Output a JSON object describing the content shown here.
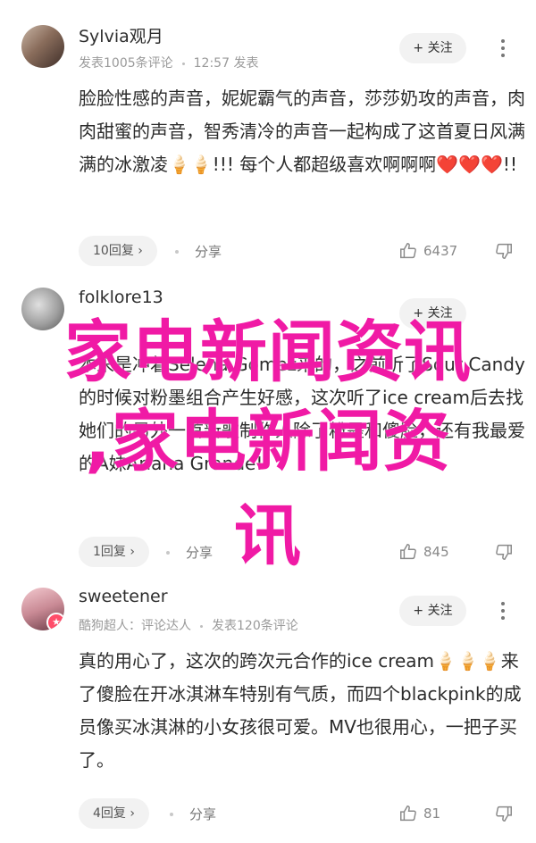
{
  "comments": [
    {
      "username": "Sylvia观月",
      "meta_prefix": "发表1005条评论",
      "time": "12:57",
      "meta_suffix": "发表",
      "follow": "+ 关注",
      "body": "脸脸性感的声音，妮妮霸气的声音，莎莎奶攻的声音，肉肉甜蜜的声音，智秀清冷的声音一起构成了这首夏日风满满的冰激凌🍦🍦!!! 每个人都超级喜欢啊啊啊❤️❤️❤️!!",
      "replies": "10回复 ›",
      "share": "分享",
      "likes": "6437"
    },
    {
      "username": "folklore13",
      "meta_prefix": "",
      "time": "",
      "meta_suffix": "",
      "follow": "+ 关注",
      "body": "本来是冲着Selena Gomez来的，之前听了Sour Candy的时候对粉墨组合产生好感，这次听了ice cream后去找她们的另外一首新歌制作人除了粉墨和傻脸，还有我最爱的A妹Ariana Grande!",
      "replies": "1回复 ›",
      "share": "分享",
      "likes": "845"
    },
    {
      "username": "sweetener",
      "meta_prefix": "酷狗超人：评论达人",
      "time": "",
      "meta_suffix": "发表120条评论",
      "follow": "+ 关注",
      "body": "真的用心了，这次的跨次元合作的ice cream🍦🍦🍦来了傻脸在开冰淇淋车特别有气质，而四个blackpink的成员像买冰淇淋的小女孩很可爱。MV也很用心，一把子买了。",
      "replies": "4回复 ›",
      "share": "分享",
      "likes": "81"
    }
  ],
  "overlay": {
    "line1": "家电新闻资讯",
    "line2": ",家电新闻资",
    "line3": "讯"
  },
  "colors": {
    "overlay": "#f01aa5",
    "badge": "#ff4d6a"
  },
  "icons": [
    "thumbs-up-icon",
    "thumbs-down-icon",
    "more-vertical-icon",
    "chevron-right-icon"
  ]
}
